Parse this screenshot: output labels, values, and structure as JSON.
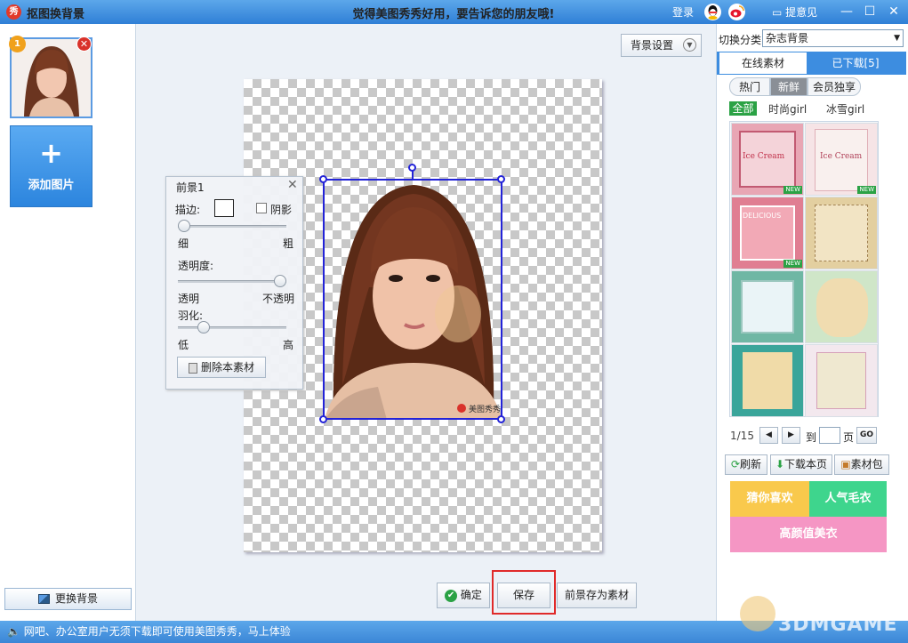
{
  "titlebar": {
    "app_title": "抠图换背景",
    "slogan": "觉得美图秀秀好用，要告诉您的朋友哦!",
    "login": "登录",
    "feedback": "提意见",
    "logo_text": "秀"
  },
  "left_panel": {
    "thumb_badge": "1",
    "add_image_label": "添加图片",
    "change_bg_label": "更换背景"
  },
  "workspace": {
    "bg_settings_label": "背景设置",
    "watermark": "美图秀秀"
  },
  "foreground_panel": {
    "title": "前景1",
    "stroke_label": "描边:",
    "shadow_label": "阴影",
    "shadow_checked": false,
    "thin_label": "细",
    "thick_label": "粗",
    "stroke_width_value": 0.0,
    "opacity_label": "透明度:",
    "transparent_label": "透明",
    "opaque_label": "不透明",
    "opacity_value": 1.0,
    "feather_label": "羽化:",
    "low_label": "低",
    "high_label": "高",
    "feather_value": 0.2,
    "delete_label": "删除本素材"
  },
  "bottom_buttons": {
    "confirm_label": "确定",
    "save_label": "保存",
    "save_fg_label": "前景存为素材"
  },
  "right_panel": {
    "category_label": "切换分类",
    "category_value": "杂志背景",
    "tabs": [
      {
        "label": "在线素材"
      },
      {
        "label": "已下载[5]"
      }
    ],
    "subtabs": [
      {
        "label": "热门"
      },
      {
        "label": "新鲜"
      },
      {
        "label": "会员独享"
      }
    ],
    "filters": [
      {
        "label": "全部"
      },
      {
        "label": "时尚girl"
      },
      {
        "label": "冰雪girl"
      }
    ],
    "thumbnails": [
      {
        "label": "Ice Cream",
        "new": true,
        "new_text": "NEW"
      },
      {
        "label": "Ice Cream",
        "new": true,
        "new_text": "NEW"
      },
      {
        "label": "DELICIOUS",
        "new": true,
        "new_text": "NEW"
      },
      {
        "label": "",
        "new": false,
        "new_text": ""
      },
      {
        "label": "",
        "new": false,
        "new_text": ""
      },
      {
        "label": "",
        "new": false,
        "new_text": ""
      },
      {
        "label": "",
        "new": false,
        "new_text": ""
      },
      {
        "label": "",
        "new": false,
        "new_text": ""
      }
    ],
    "pager": {
      "page": "1/15",
      "goto_prefix": "到",
      "goto_suffix": "页",
      "go": "GO",
      "input_value": ""
    },
    "actions": [
      {
        "label": "刷新"
      },
      {
        "label": "下载本页"
      },
      {
        "label": "素材包"
      }
    ],
    "promos": [
      {
        "label": "猜你喜欢",
        "color": "#f9c94c"
      },
      {
        "label": "人气毛衣",
        "color": "#3ed58d"
      },
      {
        "label": "高颜值美衣",
        "color": "#f596c4"
      }
    ]
  },
  "statusbar": {
    "text": "网吧、办公室用户无须下载即可使用美图秀秀，马上体验"
  },
  "corner_watermark": "3DMGAME",
  "colors": {
    "title_blue": "#3b86d6",
    "selection_blue": "#2323d8",
    "save_highlight": "#e02a2a",
    "filter_green": "#2ba245"
  }
}
